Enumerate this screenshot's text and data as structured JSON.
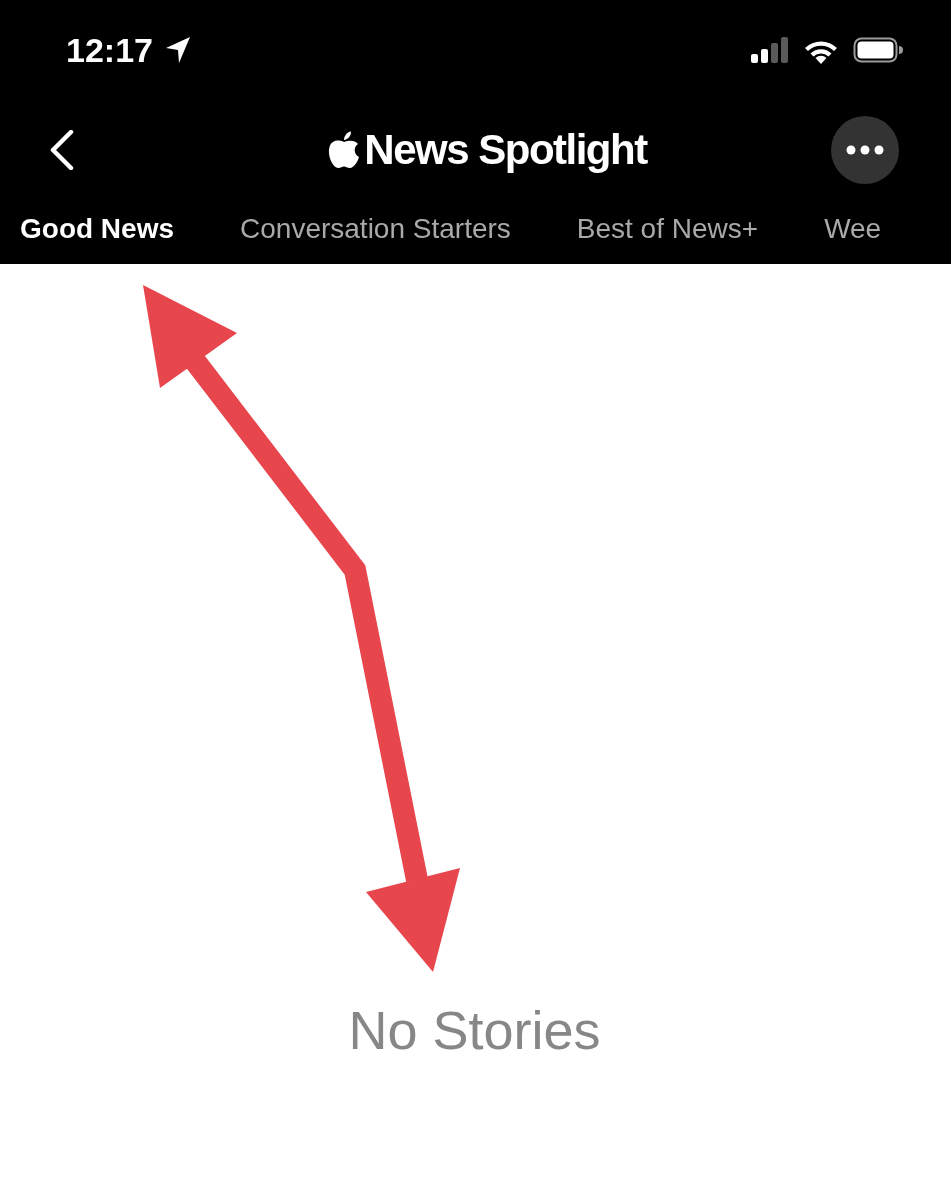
{
  "status_bar": {
    "time": "12:17"
  },
  "nav_bar": {
    "title": "News Spotlight"
  },
  "tabs": [
    {
      "label": "Good News",
      "selected": true
    },
    {
      "label": "Conversation Starters",
      "selected": false
    },
    {
      "label": "Best of News+",
      "selected": false
    },
    {
      "label": "Wee",
      "selected": false
    }
  ],
  "empty_state": {
    "message": "No Stories"
  }
}
